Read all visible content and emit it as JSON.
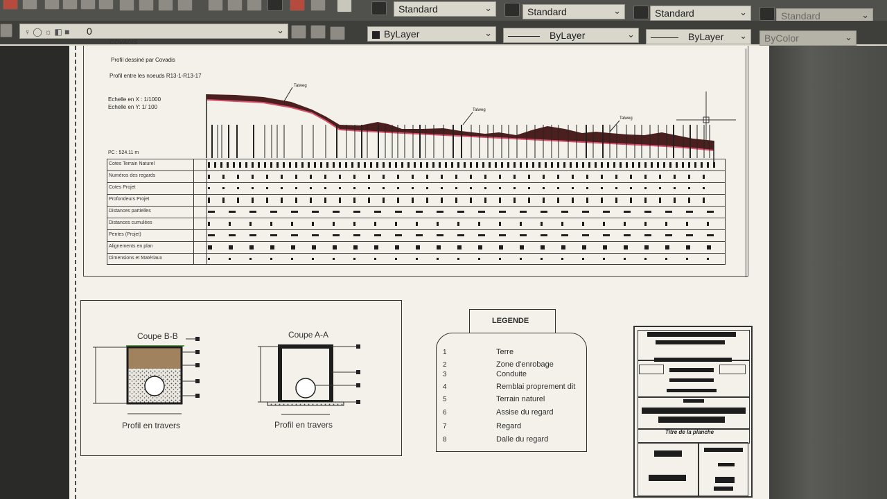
{
  "toolbar": {
    "text_style": "Standard",
    "dim_style": "Standard",
    "table_style": "Standard",
    "multileader_style": "Standard",
    "layer": "0",
    "color": "ByLayer",
    "linetype": "ByLayer",
    "lineweight": "ByLayer",
    "plot_style": "ByColor"
  },
  "profile": {
    "logo": "COVADIS",
    "drawn_by": "Profil dessiné par Covadis",
    "between_nodes": "Profil entre les noeuds R13-1-R13-17",
    "scale_x": "Echelle en X : 1/1000",
    "scale_y": "Echelle en Y: 1/ 100",
    "pc": "PC : 524.11 m",
    "talweg": "Talweg",
    "rows": [
      "Cotes Terrain Naturel",
      "Numéros des regards",
      "Cotes Projet",
      "Profondeurs Projet",
      "Distances partielles",
      "Distances cumulées",
      "Pentes (Projet)",
      "Alignements en plan",
      "Dimensions et Matériaux"
    ]
  },
  "sections": {
    "b_title": "Coupe B-B",
    "a_title": "Coupe A-A",
    "b_caption": "Profil en travers",
    "a_caption": "Profil en travers"
  },
  "legend": {
    "title": "LEGENDE",
    "items": [
      {
        "n": "1",
        "label": "Terre"
      },
      {
        "n": "2",
        "label": "Zone d'enrobage"
      },
      {
        "n": "3",
        "label": "Conduite"
      },
      {
        "n": "4",
        "label": "Remblai proprement dit"
      },
      {
        "n": "5",
        "label": "Terrain naturel"
      },
      {
        "n": "6",
        "label": "Assise du regard"
      },
      {
        "n": "7",
        "label": "Regard"
      },
      {
        "n": "8",
        "label": "Dalle du regard"
      }
    ]
  },
  "title_block": {
    "sheet_title": "Titre de la planche"
  },
  "colors": {
    "terrain": "#4a1f1e",
    "project_line": "#d9506e",
    "topsoil": "#a0825e"
  }
}
